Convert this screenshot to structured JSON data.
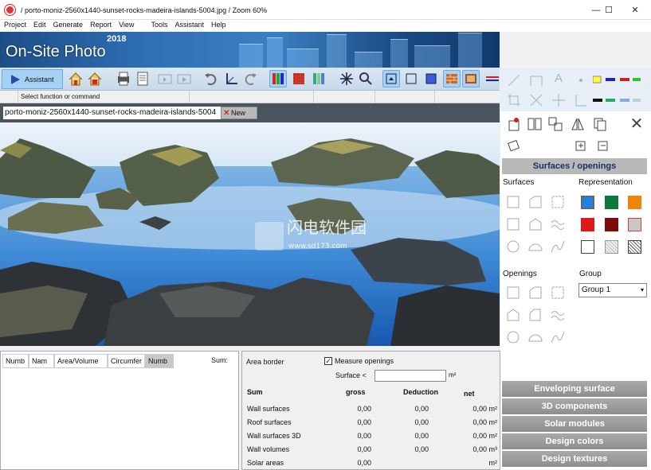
{
  "window": {
    "title": "/ porto-moniz-2560x1440-sunset-rocks-madeira-islands-5004.jpg / Zoom 60%",
    "minimize": "—",
    "maximize": "☐",
    "close": "✕"
  },
  "menu": [
    "Project",
    "Edit",
    "Generate",
    "Report",
    "View",
    "Tools",
    "Assistant",
    "Help"
  ],
  "banner": {
    "product": "On-Site Photo",
    "year": "2018"
  },
  "toolbar": {
    "assistant_label": "Assistant"
  },
  "status": {
    "prompt": "Select function or command"
  },
  "document": {
    "name": "porto-moniz-2560x1440-sunset-rocks-madeira-islands-5004",
    "new_label": "New"
  },
  "list": {
    "columns": [
      "Numb",
      "Nam",
      "Area/Volume",
      "Circumfer",
      "Numb"
    ],
    "sum_label": "Sum:"
  },
  "area": {
    "border_label": "Area border",
    "measure_openings_label": "Measure openings",
    "measure_openings_checked": true,
    "surface_label": "Surface <",
    "surface_value": "",
    "unit": "m²",
    "headers": {
      "sum": "Sum",
      "gross": "gross",
      "deduction": "Deduction",
      "net": "net"
    },
    "rows": [
      {
        "name": "Wall surfaces",
        "gross": "0,00",
        "deduction": "0,00",
        "net": "0,00 m²"
      },
      {
        "name": "Roof surfaces",
        "gross": "0,00",
        "deduction": "0,00",
        "net": "0,00 m²"
      },
      {
        "name": "Wall surfaces 3D",
        "gross": "0,00",
        "deduction": "0,00",
        "net": "0,00 m²"
      },
      {
        "name": "Wall volumes",
        "gross": "0,00",
        "deduction": "0,00",
        "net": "0,00 m³"
      },
      {
        "name": "Solar areas",
        "gross": "0,00",
        "deduction": "",
        "net": "m²"
      }
    ]
  },
  "panel": {
    "surfaces_header": "Surfaces / openings",
    "surfaces_label": "Surfaces",
    "representation_label": "Representation",
    "openings_label": "Openings",
    "group_label": "Group",
    "group_value": "Group 1",
    "swatches": [
      "#1e82e6",
      "#0a7a3a",
      "#f2830a",
      "#e01818",
      "#7a0c0c",
      "#c8c8c8",
      "#ffffff",
      "#dcdcdc",
      "#bdbdbd"
    ],
    "sections": [
      "Enveloping surface",
      "3D components",
      "Solar modules",
      "Design colors",
      "Design textures"
    ]
  },
  "watermark": {
    "cn": "闪电软件园",
    "url": "www.sd173.com"
  }
}
